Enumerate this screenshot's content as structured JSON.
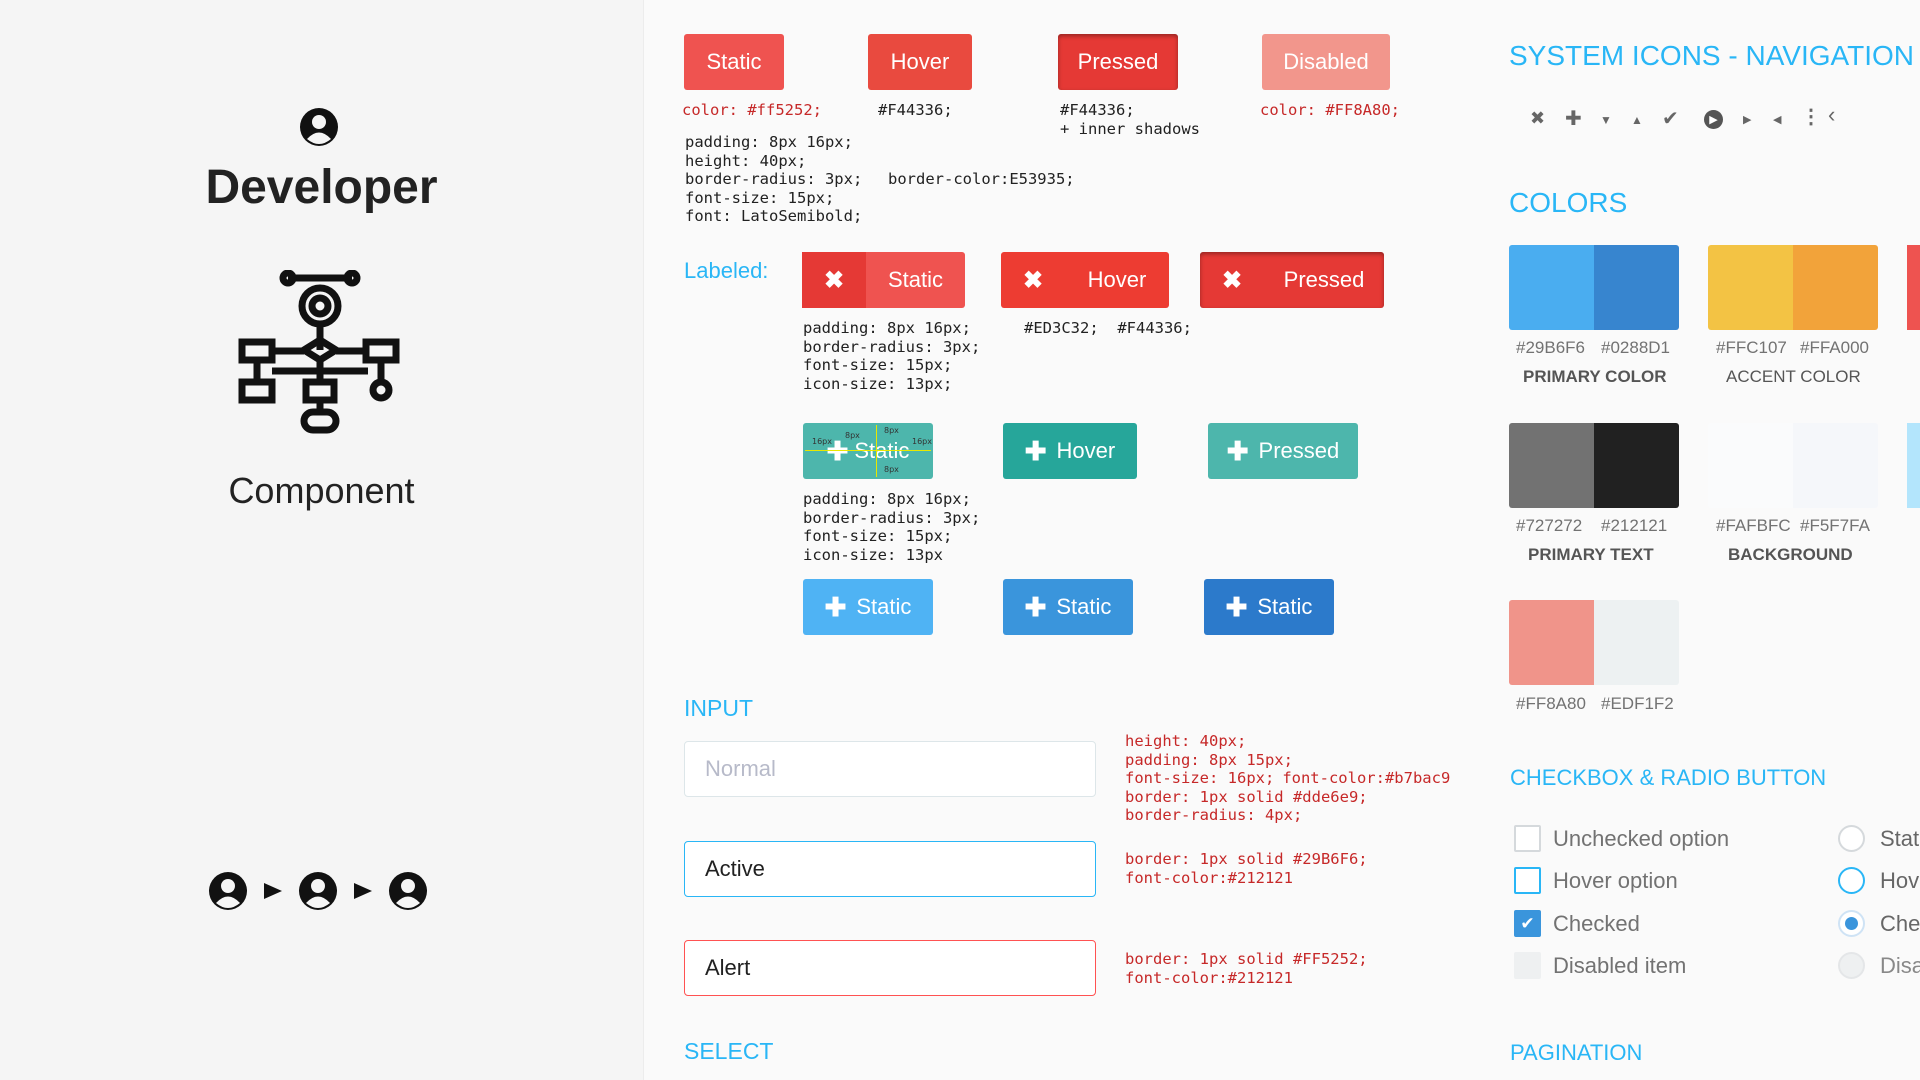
{
  "left": {
    "title": "Developer",
    "subtitle": "Component"
  },
  "buttons": {
    "row1": [
      {
        "label": "Static",
        "bg": "#ef5350"
      },
      {
        "label": "Hover",
        "bg": "#F44336"
      },
      {
        "label": "Pressed",
        "bg": "#E53935"
      },
      {
        "label": "Disabled",
        "bg": "#FF8A80"
      }
    ],
    "row1_notes": [
      "color: #ff5252;",
      "#F44336;",
      "#F44336;",
      "+ inner shadows",
      "color: #FF8A80;"
    ],
    "row1_spec": [
      "padding: 8px 16px;",
      "height: 40px;",
      "border-radius: 3px;",
      "font-size: 15px;",
      "font: LatoSemibold;"
    ],
    "row1_border": "border-color:E53935;",
    "labeled_title": "Labeled:",
    "row2": [
      {
        "label": "Static",
        "icon": "close-icon"
      },
      {
        "label": "Hover",
        "icon": "close-icon"
      },
      {
        "label": "Pressed",
        "icon": "close-icon"
      }
    ],
    "row2_spec": [
      "padding: 8px 16px;",
      "border-radius: 3px;",
      "font-size: 15px;",
      "icon-size: 13px;"
    ],
    "row2_note": "#ED3C32;  #F44336;",
    "row3": [
      {
        "label": "Static",
        "icon": "plus-icon",
        "bg": "#4DB6AC"
      },
      {
        "label": "Hover",
        "icon": "plus-icon",
        "bg": "#26A69A"
      },
      {
        "label": "Pressed",
        "icon": "plus-icon",
        "bg": "#4DB6AC"
      }
    ],
    "row3_measure": [
      "16px",
      "8px",
      "8px",
      "16px",
      "8px"
    ],
    "row3_spec": [
      "padding: 8px 16px;",
      "border-radius: 3px;",
      "font-size: 15px;",
      "icon-size: 13px"
    ],
    "row4": [
      {
        "label": "Static",
        "icon": "plus-icon",
        "bg": "#4FC3F7"
      },
      {
        "label": "Static",
        "icon": "plus-icon",
        "bg": "#3A95DC"
      },
      {
        "label": "Static",
        "icon": "plus-icon",
        "bg": "#2C7ACB"
      }
    ]
  },
  "input": {
    "title": "INPUT",
    "fields": [
      {
        "placeholder": "Normal",
        "value": ""
      },
      {
        "placeholder": "",
        "value": "Active"
      },
      {
        "placeholder": "",
        "value": "Alert"
      }
    ],
    "spec_normal": [
      "height: 40px;",
      "padding: 8px 15px;",
      "font-size: 16px;",
      "font-color:#b7bac9",
      "border: 1px solid #dde6e9;",
      "border-radius: 4px;"
    ],
    "spec_active": [
      "border: 1px solid #29B6F6;",
      "font-color:#212121"
    ],
    "spec_alert": [
      "border: 1px solid #FF5252;",
      "font-color:#212121"
    ]
  },
  "select": {
    "title": "SELECT"
  },
  "right": {
    "nav_title": "SYSTEM ICONS - NAVIGATION",
    "nav_icons": [
      "close-icon",
      "plus-icon",
      "caret-down-icon",
      "caret-up-icon",
      "check-icon",
      "arrow-circle-icon",
      "caret-right-icon",
      "caret-left-icon",
      "more-vertical-icon",
      "chevron-left-icon"
    ],
    "colors_title": "COLORS",
    "swatches": [
      {
        "a": "#29B6F6",
        "b": "#0288D1",
        "name": "PRIMARY COLOR",
        "ca": "#4AADF0",
        "cb": "#3785CF"
      },
      {
        "a": "#FFC107",
        "b": "#FFA000",
        "name": "ACCENT COLOR",
        "ca": "#F3C344",
        "cb": "#F2A33A"
      },
      {
        "a": "#727272",
        "b": "#212121",
        "name": "PRIMARY TEXT",
        "ca": "#727272",
        "cb": "#212121"
      },
      {
        "a": "#FAFBFC",
        "b": "#F5F7FA",
        "name": "BACKGROUND",
        "ca": "#FAFBFC",
        "cb": "#F5F7FA"
      },
      {
        "a": "#FF8A80",
        "b": "#EDF1F2",
        "name": "",
        "ca": "#F0948A",
        "cb": "#EDF1F2"
      }
    ],
    "check_title": "CHECKBOX & RADIO BUTTON",
    "checkbox_options": [
      "Unchecked option",
      "Hover option",
      "Checked",
      "Disabled item"
    ],
    "radio_options": [
      "Stat",
      "Hov",
      "Che",
      "Disa"
    ],
    "pagination_title": "PAGINATION"
  }
}
